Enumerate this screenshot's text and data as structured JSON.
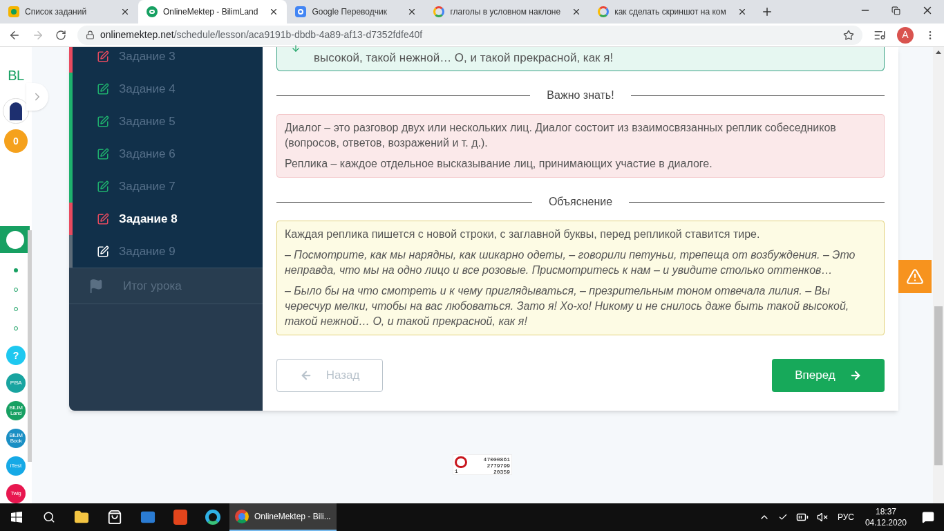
{
  "browser": {
    "tabs": [
      {
        "title": "Список заданий",
        "kind": "classroom",
        "selected": false
      },
      {
        "title": "OnlineMektep - BilimLand",
        "kind": "bilim",
        "selected": true
      },
      {
        "title": "Google Переводчик",
        "kind": "translate",
        "selected": false
      },
      {
        "title": "глаголы в условном наклоне",
        "kind": "google",
        "selected": false
      },
      {
        "title": "как сделать скриншот на ком",
        "kind": "google",
        "selected": false
      }
    ],
    "url_host": "onlinemektep.net",
    "url_path": "/schedule/lesson/aca9191b-dbdb-4a89-af13-d7352fdfe40f",
    "profile_initial": "A"
  },
  "rail": {
    "logo": "BL",
    "score": "0",
    "steps": [
      {
        "selected": true
      },
      {
        "selected": false
      },
      {
        "selected": false
      },
      {
        "selected": false
      }
    ],
    "apps": [
      {
        "kind": "help",
        "label": "?",
        "color": "#1ec8f0"
      },
      {
        "kind": "logo",
        "label": "PISA",
        "color": "#18a4a0"
      },
      {
        "kind": "logo",
        "label": "BILIM Land",
        "color": "#17a062"
      },
      {
        "kind": "logo",
        "label": "BILIM Book",
        "color": "#1a8fc4"
      },
      {
        "kind": "test",
        "label": "iTest",
        "color": "#16a9e6"
      },
      {
        "kind": "logo",
        "label": "Twig",
        "color": "#e8174f"
      }
    ]
  },
  "lesson": {
    "tasks": [
      {
        "label": "Задание 3",
        "kind": "wrong",
        "selected": false
      },
      {
        "label": "Задание 4",
        "kind": "right",
        "selected": false
      },
      {
        "label": "Задание 5",
        "kind": "right",
        "selected": false
      },
      {
        "label": "Задание 6",
        "kind": "right",
        "selected": false
      },
      {
        "label": "Задание 7",
        "kind": "right",
        "selected": false
      },
      {
        "label": "Задание 8",
        "kind": "wrong",
        "selected": true
      },
      {
        "label": "Задание 9",
        "kind": "none",
        "selected": false
      }
    ],
    "summary": "Итог урока",
    "answer_tail": "высокой, такой нежной… О, и такой прекрасной, как я!",
    "sections": [
      {
        "title": "Важно знать!",
        "kind": "pink",
        "paragraphs": [
          {
            "text": "Диалог – это разговор двух или нескольких лиц. Диалог состоит из взаимосвязанных реплик собеседников (вопросов, ответов, возражений и т. д.).",
            "italic": false
          },
          {
            "text": "Реплика – каждое отдельное высказывание лиц, принимающих участие в диалоге.",
            "italic": false
          }
        ]
      },
      {
        "title": "Объяснение",
        "kind": "yellow",
        "paragraphs": [
          {
            "text": "Каждая реплика пишется с новой строки, с заглавной буквы, перед репликой ставится тире.",
            "italic": false
          },
          {
            "text": "– Посмотрите, как мы нарядны, как шикарно одеты, – говорили петуньи, трепеща от возбуждения. – Это неправда, что мы на одно лицо и все розовые. Присмотритесь к нам – и увидите столько оттенков…",
            "italic": true
          },
          {
            "text": "– Было бы на что смотреть и к чему приглядываться, – презрительным тоном отвечала лилия. – Вы чересчур мелки, чтобы на вас любоваться. Зато я! Хо-хо! Никому и не снилось даже быть такой высокой, такой нежной… О, и такой прекрасной, как я!",
            "italic": true
          }
        ]
      }
    ],
    "back_button": {
      "label": "Назад",
      "disabled": true
    },
    "next_button": {
      "label": "Вперед",
      "disabled": false
    }
  },
  "counter": {
    "lines": [
      "47000861",
      "2779799",
      "20359"
    ],
    "index": "1"
  },
  "taskbar": {
    "active_window": "OnlineMektep - Bili...",
    "language": "РУС",
    "time": "18:37",
    "date": "04.12.2020"
  }
}
